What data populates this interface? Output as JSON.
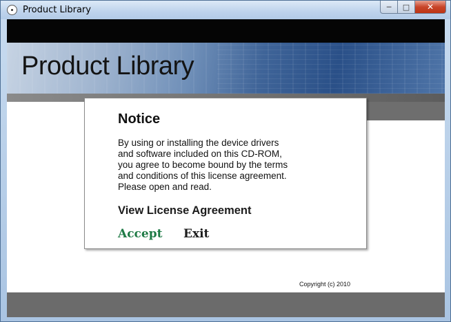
{
  "window": {
    "title": "Product Library",
    "controls": {
      "minimize": "─",
      "maximize": "□",
      "close": "✕"
    }
  },
  "banner": {
    "title": "Product Library"
  },
  "notice": {
    "title": "Notice",
    "body_lines": [
      "By using or installing the device drivers",
      "and software included on this CD-ROM,",
      "you agree to become bound by the terms",
      "and conditions of this license agreement.",
      "Please open and read."
    ],
    "view_license_label": "View License Agreement",
    "accept_label": "Accept",
    "exit_label": "Exit"
  },
  "footer": {
    "copyright": "Copyright (c) 2010"
  },
  "colors": {
    "accept": "#1e7a45",
    "banner_blue": "#2a5088",
    "band_gray": "#6b6b6b"
  }
}
